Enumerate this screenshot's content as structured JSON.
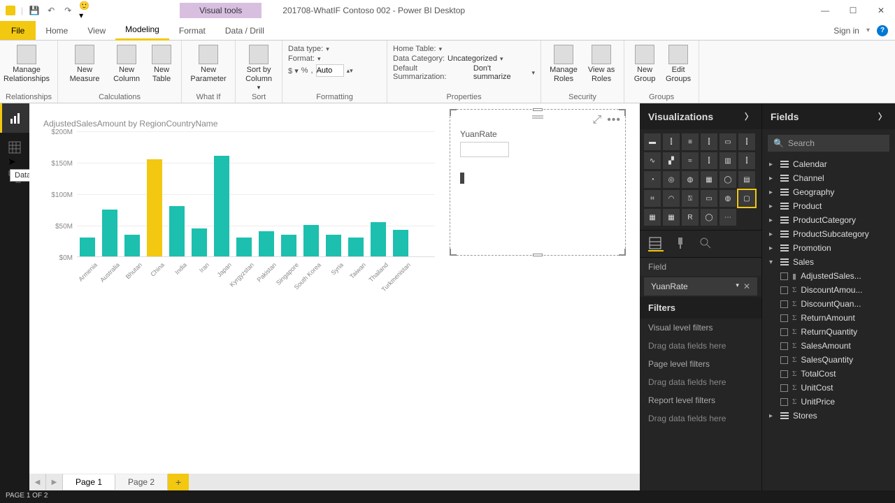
{
  "titlebar": {
    "contextual": "Visual tools",
    "title": "201708-WhatIF Contoso 002 - Power BI Desktop"
  },
  "tabs": {
    "file": "File",
    "items": [
      "Home",
      "View",
      "Modeling",
      "Format",
      "Data / Drill"
    ],
    "active": 2,
    "signin": "Sign in"
  },
  "ribbon": {
    "groups": [
      {
        "label": "Relationships",
        "buttons": [
          "Manage Relationships"
        ]
      },
      {
        "label": "Calculations",
        "buttons": [
          "New Measure",
          "New Column",
          "New Table"
        ]
      },
      {
        "label": "What If",
        "buttons": [
          "New Parameter"
        ]
      },
      {
        "label": "Sort",
        "buttons": [
          "Sort by Column"
        ]
      },
      {
        "label": "Formatting",
        "rows": [
          {
            "k": "Data type:",
            "v": ""
          },
          {
            "k": "Format:",
            "v": ""
          },
          {
            "k2": "$ · % · , ",
            "input": "Auto"
          }
        ]
      },
      {
        "label": "Properties",
        "rows": [
          {
            "k": "Home Table:",
            "v": ""
          },
          {
            "k": "Data Category:",
            "v": "Uncategorized"
          },
          {
            "k": "Default Summarization:",
            "v": "Don't summarize"
          }
        ]
      },
      {
        "label": "Security",
        "buttons": [
          "Manage Roles",
          "View as Roles"
        ]
      },
      {
        "label": "Groups",
        "buttons": [
          "New Group",
          "Edit Groups"
        ]
      }
    ]
  },
  "leftnav": {
    "tooltip": "Data"
  },
  "chart": {
    "title": "AdjustedSalesAmount by RegionCountryName"
  },
  "chart_data": {
    "type": "bar",
    "ylabel": "",
    "ylim": [
      0,
      200
    ],
    "yticks": [
      "$200M",
      "$150M",
      "$100M",
      "$50M",
      "$0M"
    ],
    "categories": [
      "Armenia",
      "Australia",
      "Bhutan",
      "China",
      "India",
      "Iran",
      "Japan",
      "Kyrgyzstan",
      "Pakistan",
      "Singapore",
      "South Korea",
      "Syria",
      "Taiwan",
      "Thailand",
      "Turkmenistan"
    ],
    "values": [
      30,
      75,
      35,
      155,
      80,
      45,
      160,
      30,
      40,
      35,
      50,
      35,
      30,
      55,
      42
    ],
    "highlight_index": 3,
    "title": "AdjustedSalesAmount by RegionCountryName"
  },
  "slicer": {
    "title": "YuanRate"
  },
  "pages": {
    "tabs": [
      "Page 1",
      "Page 2"
    ],
    "add": "+"
  },
  "statusbar": {
    "text": "PAGE 1 OF 2"
  },
  "viz": {
    "header": "Visualizations",
    "field_label": "Field",
    "field_value": "YuanRate",
    "filters": "Filters",
    "vlf": "Visual level filters",
    "drag1": "Drag data fields here",
    "plf": "Page level filters",
    "drag2": "Drag data fields here",
    "rlf": "Report level filters",
    "drag3": "Drag data fields here"
  },
  "fields": {
    "header": "Fields",
    "search": "Search",
    "tables": [
      "Calendar",
      "Channel",
      "Geography",
      "Product",
      "ProductCategory",
      "ProductSubcategory",
      "Promotion"
    ],
    "sales": "Sales",
    "sales_fields": [
      {
        "n": "AdjustedSales...",
        "t": "measure"
      },
      {
        "n": "DiscountAmou...",
        "t": "sum"
      },
      {
        "n": "DiscountQuan...",
        "t": "sum"
      },
      {
        "n": "ReturnAmount",
        "t": "sum"
      },
      {
        "n": "ReturnQuantity",
        "t": "sum"
      },
      {
        "n": "SalesAmount",
        "t": "sum"
      },
      {
        "n": "SalesQuantity",
        "t": "sum"
      },
      {
        "n": "TotalCost",
        "t": "sum"
      },
      {
        "n": "UnitCost",
        "t": "sum"
      },
      {
        "n": "UnitPrice",
        "t": "sum"
      }
    ],
    "stores": "Stores"
  }
}
